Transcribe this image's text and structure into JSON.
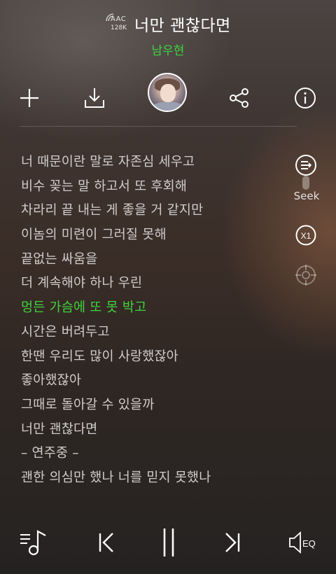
{
  "player": {
    "codec": "AAC",
    "bitrate": "128K",
    "title": "너만 괜찮다면",
    "artist": "남우현"
  },
  "toolbar": {
    "icons": [
      "add-to-playlist-icon",
      "download-icon",
      "album-art",
      "share-icon",
      "info-icon"
    ]
  },
  "lyrics": {
    "lines": [
      "너 때문이란 말로 자존심 세우고",
      "비수 꽂는 말 하고서 또 후회해",
      "차라리 끝 내는 게 좋을 거 같지만",
      "이놈의 미련이 그러질 못해",
      "끝없는 싸움을",
      "더 계속해야 하나 우린",
      "멍든 가슴에 또 못 박고",
      "시간은 버려두고",
      "한땐 우리도 많이 사랑했잖아",
      "좋아했잖아",
      "그때로 돌아갈 수 있을까",
      "너만 괜찮다면",
      "– 연주중 –",
      "괜한 의심만 했나 너를 믿지 못했나"
    ],
    "current_index": 6
  },
  "side": {
    "seek_label": "Seek",
    "speed_label": "X1"
  },
  "controls": {
    "eq_label": "EQ"
  },
  "colors": {
    "accent_green": "#3fd33f",
    "lyric_text": "#d0cccb"
  }
}
